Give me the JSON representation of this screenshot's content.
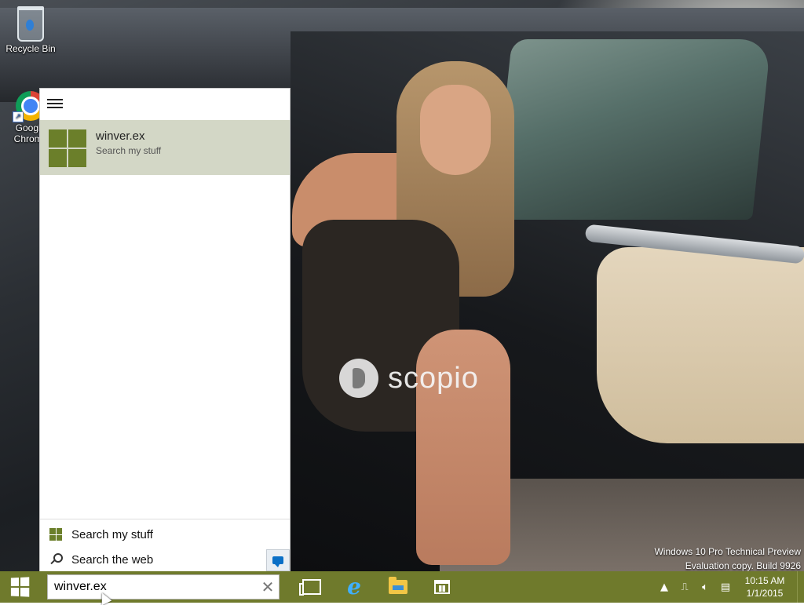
{
  "desktop": {
    "icons": [
      {
        "label": "Recycle Bin",
        "icon": "recycle-bin-icon"
      },
      {
        "label": "Google Chrome",
        "icon": "chrome-icon"
      }
    ],
    "watermark": "scopio",
    "build_info": {
      "line1": "Windows 10 Pro Technical Preview",
      "line2": "Evaluation copy. Build 9926"
    }
  },
  "search_panel": {
    "menu_icon": "hamburger-icon",
    "result": {
      "title": "winver.ex",
      "subtitle": "Search my stuff",
      "icon": "windows-tile-icon"
    },
    "footer": {
      "search_my_stuff": "Search my stuff",
      "search_the_web": "Search the web",
      "feedback_icon": "feedback-icon"
    }
  },
  "taskbar": {
    "color": "#6f7a2c",
    "search": {
      "value": "winver.ex"
    },
    "apps": [
      {
        "name": "Task View",
        "icon": "task-view-icon"
      },
      {
        "name": "Internet Explorer",
        "icon": "internet-explorer-icon"
      },
      {
        "name": "File Explorer",
        "icon": "file-explorer-icon"
      },
      {
        "name": "Store",
        "icon": "store-icon"
      }
    ],
    "tray": {
      "time": "10:15 AM",
      "date": "1/1/2015"
    }
  },
  "colors": {
    "accent": "#6b7f2a",
    "result_highlight": "#d3d7c6"
  }
}
